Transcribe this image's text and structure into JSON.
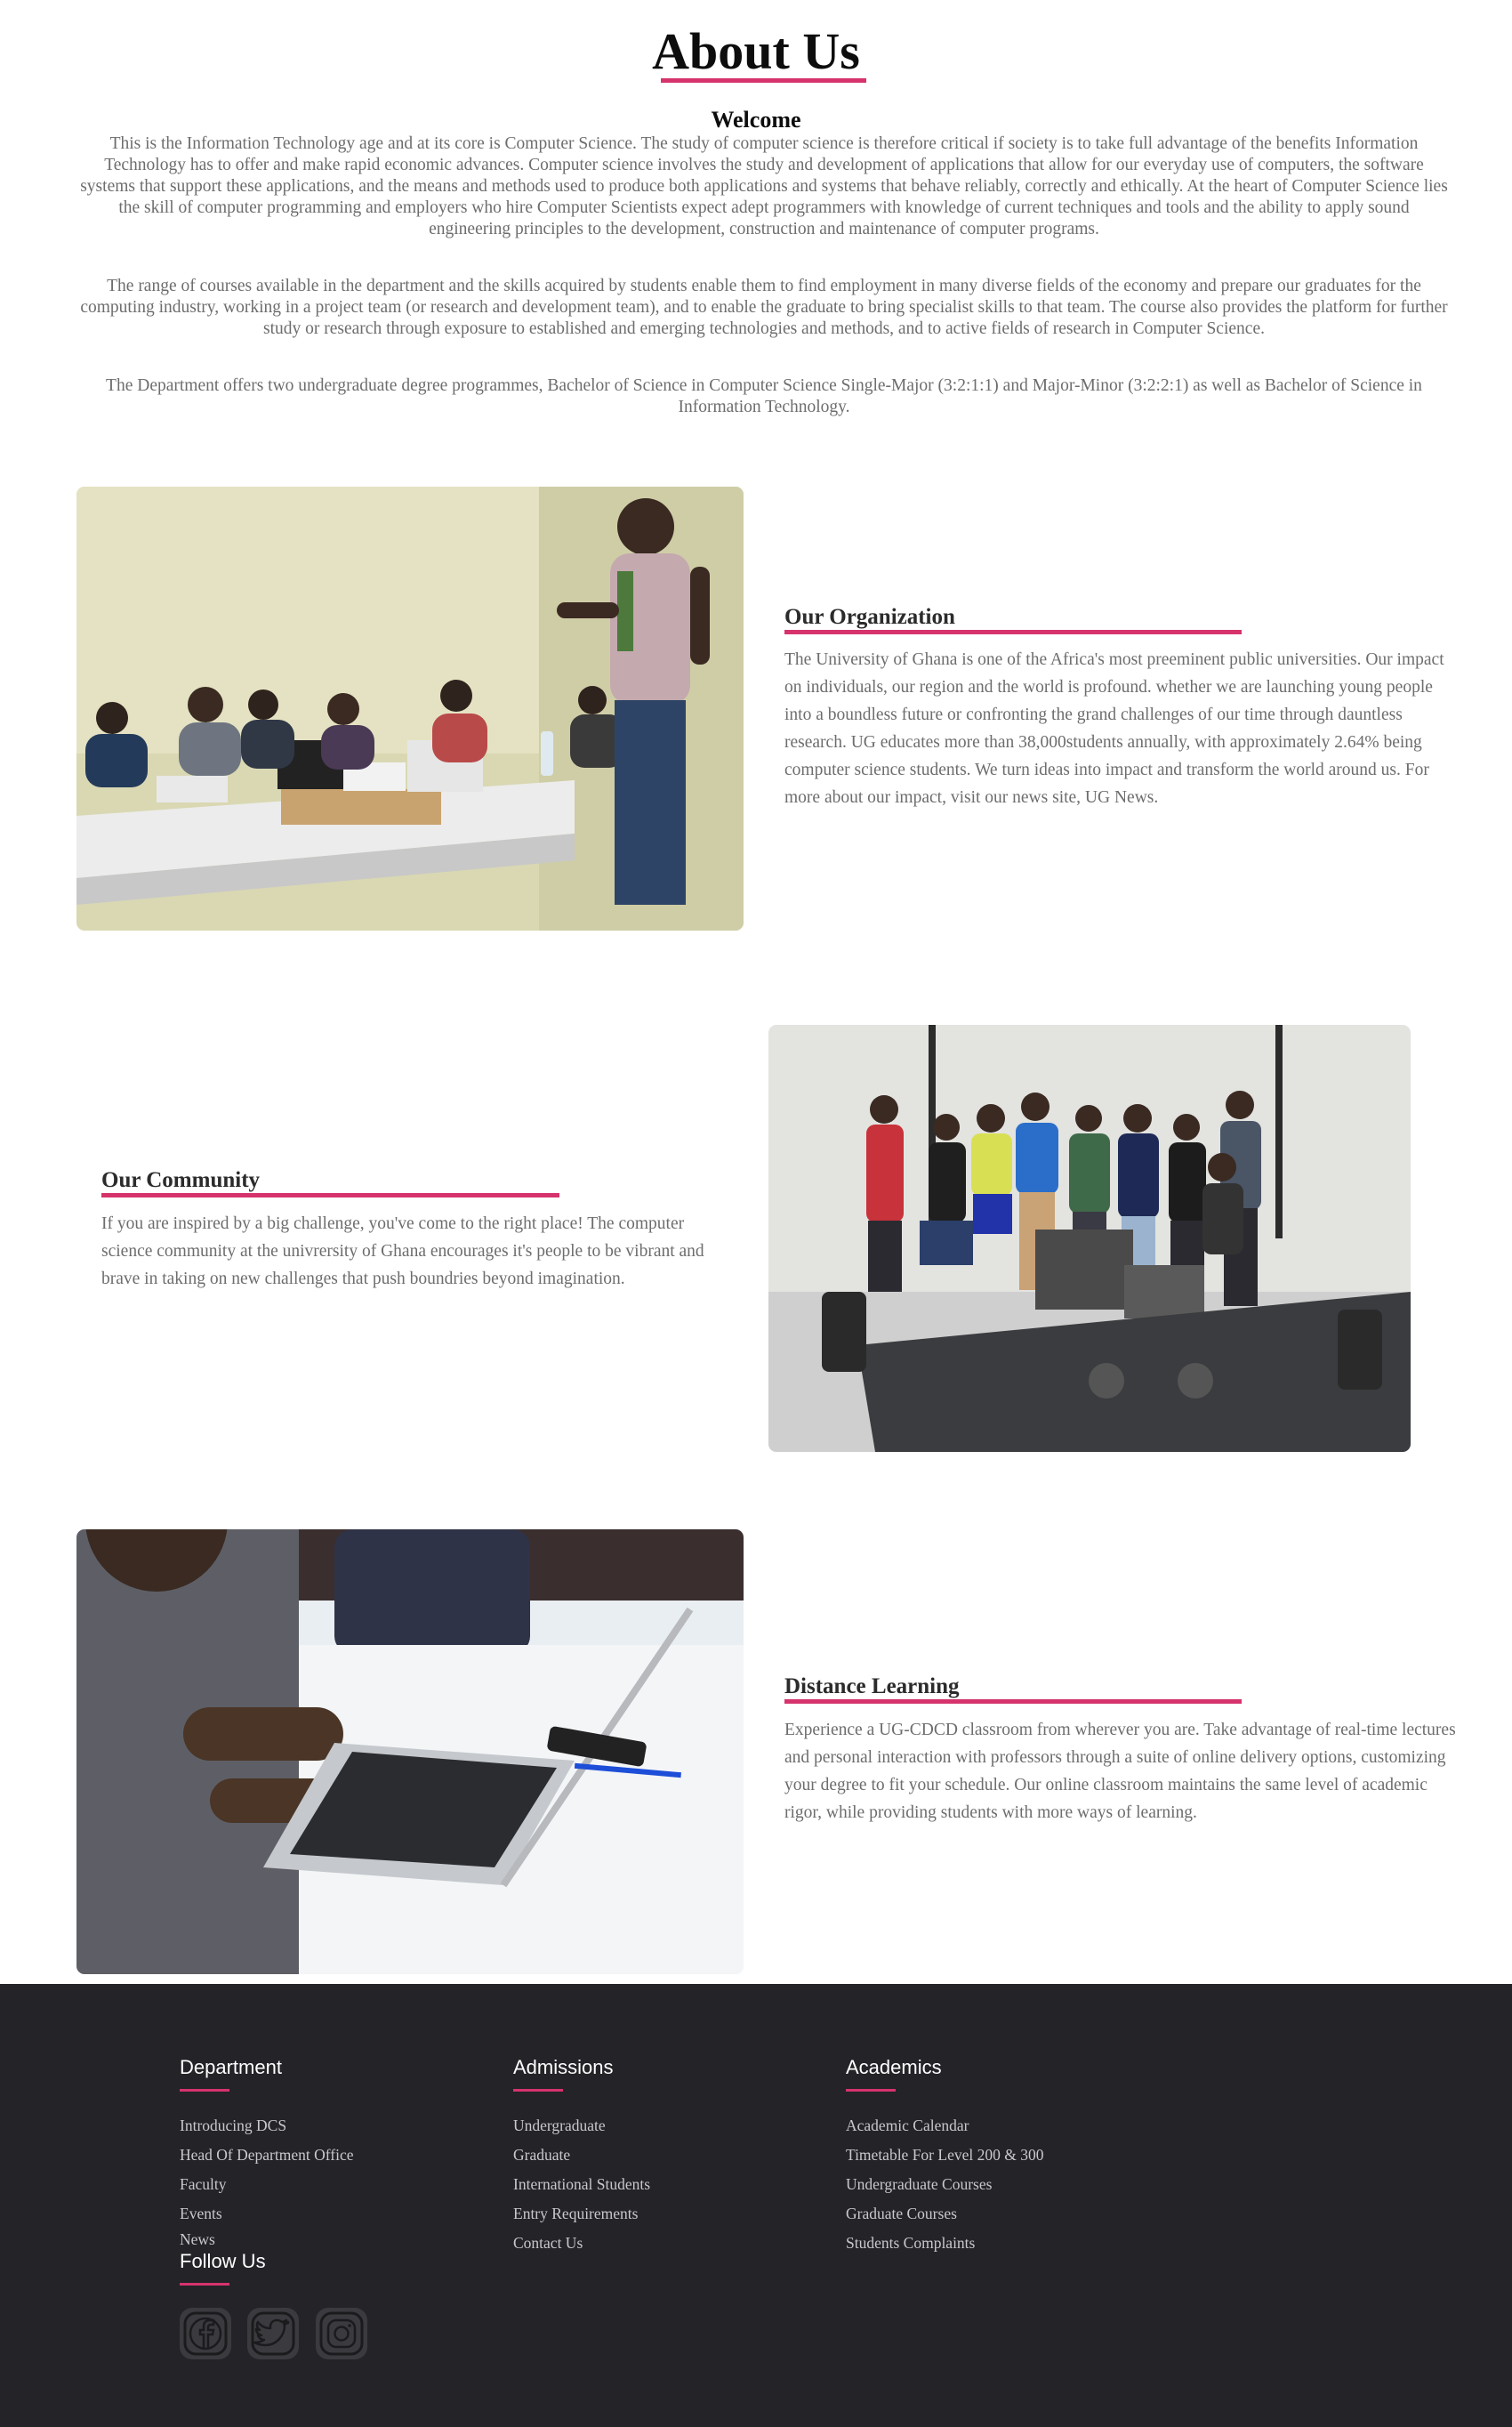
{
  "header": {
    "title": "About Us",
    "welcome": "Welcome",
    "paragraphs": [
      "This is the Information Technology age and at its core is Computer Science. The study of computer science is therefore critical if society is to take full advantage of the benefits Information Technology has to offer and make rapid economic advances. Computer science involves the study and development of applications that allow for our everyday use of computers, the software systems that support these applications, and the means and methods used to produce both applications and systems that behave reliably, correctly and ethically. At the heart of Computer Science lies the skill of computer programming and employers who hire Computer Scientists expect adept programmers with knowledge of current techniques and tools and the ability to apply sound engineering principles to the development, construction and maintenance of computer programs.",
      "The range of courses available in the department and the skills acquired by students enable them to find employment in many diverse fields of the economy and prepare our graduates for the computing industry, working in a project team (or research and development team), and to enable the graduate to bring specialist skills to that team. The course also provides the platform for further study or research through exposure to established and emerging technologies and methods, and to active fields of research in Computer Science.",
      "The Department offers two undergraduate degree programmes, Bachelor of Science in Computer Science Single-Major (3:2:1:1) and Major-Minor (3:2:2:1) as well as Bachelor of Science in Information Technology."
    ]
  },
  "sections": {
    "organization": {
      "heading": "Our Organization",
      "text": "The University of Ghana is one of the Africa's most preeminent public universities. Our impact on individuals, our region and the world is profound. whether we are launching young people into a boundless future or confronting the grand challenges of our time through dauntless research. UG educates more than 38,000students annually, with approximately 2.64% being computer science students. We turn ideas into impact and transform the world around us. For more about our impact, visit our news site, UG News."
    },
    "community": {
      "heading": "Our Community",
      "text": "If you are inspired by a big challenge, you've come to the right place! The computer science community at the univrersity of Ghana encourages it's people to be vibrant and brave in taking on new challenges that push boundries beyond imagination."
    },
    "distance": {
      "heading": "Distance Learning",
      "text": "Experience a UG-CDCD classroom from wherever you are. Take advantage of real-time lectures and personal interaction with professors through a suite of online delivery options, customizing your degree to fit your schedule. Our online classroom maintains the same level of academic rigor, while providing students with more ways of learning."
    }
  },
  "footer": {
    "department": {
      "heading": "Department",
      "links": [
        "Introducing DCS",
        "Head Of Department Office",
        "Faculty",
        "Events",
        "News"
      ]
    },
    "admissions": {
      "heading": "Admissions",
      "links": [
        "Undergraduate",
        "Graduate",
        "International Students",
        "Entry Requirements",
        "Contact Us"
      ]
    },
    "academics": {
      "heading": "Academics",
      "links": [
        "Academic Calendar",
        "Timetable For Level 200 & 300",
        "Undergraduate Courses",
        "Graduate Courses",
        "Students Complaints"
      ]
    },
    "follow": {
      "heading": "Follow Us",
      "icons": [
        "facebook-icon",
        "twitter-icon",
        "instagram-icon"
      ]
    }
  },
  "colors": {
    "accent": "#d6336c",
    "footer_bg": "#232328",
    "body_text": "#6d6d6d"
  }
}
